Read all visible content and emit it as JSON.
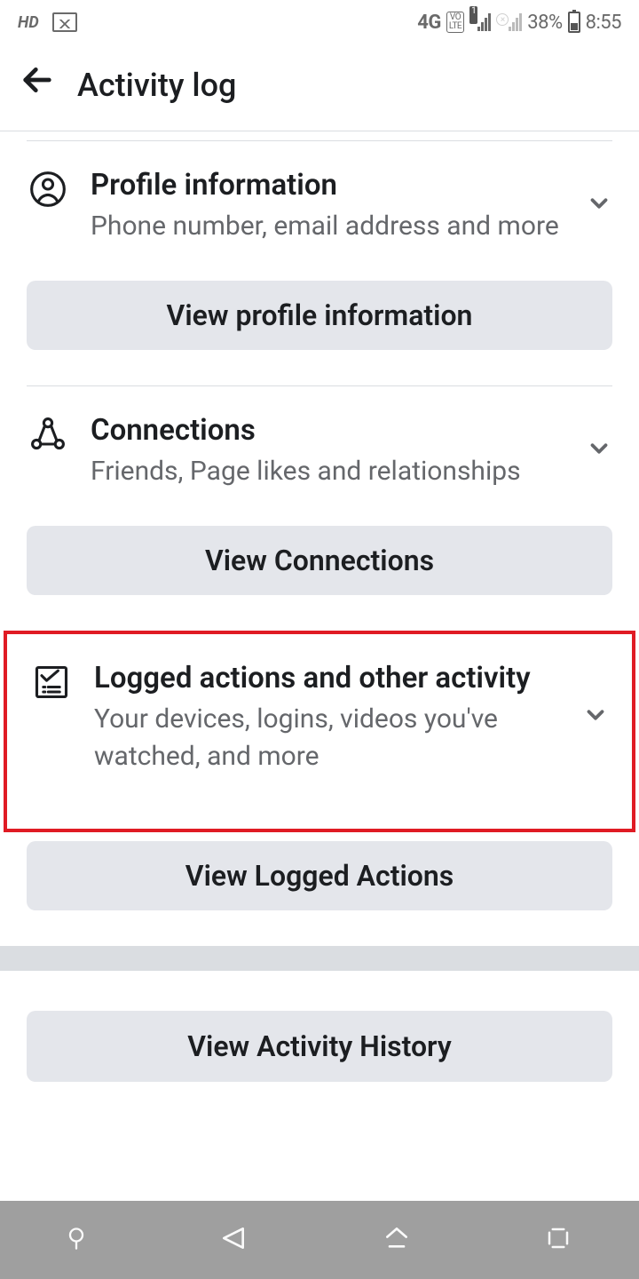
{
  "status_bar": {
    "hd": "HD",
    "network": "4G",
    "volte_top": "VO",
    "volte_bottom": "LTE",
    "battery_pct": "38%",
    "time": "8:55"
  },
  "header": {
    "title": "Activity log"
  },
  "sections": {
    "profile": {
      "title": "Profile information",
      "sub": "Phone number, email address and more",
      "button": "View profile information"
    },
    "connections": {
      "title": "Connections",
      "sub": "Friends, Page likes and relationships",
      "button": "View Connections"
    },
    "logged": {
      "title": "Logged actions and other activity",
      "sub": "Your devices, logins, videos you've watched, and more",
      "button": "View Logged Actions"
    },
    "history": {
      "button": "View Activity History"
    }
  }
}
